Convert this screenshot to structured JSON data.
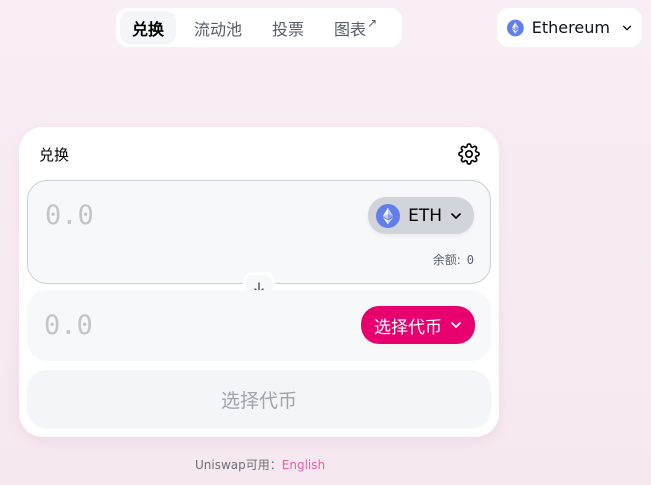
{
  "nav": {
    "tabs": [
      {
        "label": "兑换",
        "active": true
      },
      {
        "label": "流动池"
      },
      {
        "label": "投票"
      },
      {
        "label": "图表",
        "external": true
      }
    ],
    "external_arrow": "↗"
  },
  "network": {
    "label": "Ethereum",
    "icon": "ethereum-icon"
  },
  "swap": {
    "title": "兑换",
    "settings_icon": "gear-icon",
    "input": {
      "amount_placeholder": "0.0",
      "token": "ETH",
      "balance_label": "余额:",
      "balance_value": "0"
    },
    "output": {
      "amount_placeholder": "0.0",
      "select_label": "选择代币"
    },
    "switch_icon": "arrow-down-icon",
    "main_button": "选择代币"
  },
  "footer": {
    "text": "Uniswap可用：",
    "link": "English"
  },
  "colors": {
    "accent": "#e8006f",
    "link": "#e363a4",
    "eth": "#627eea"
  }
}
